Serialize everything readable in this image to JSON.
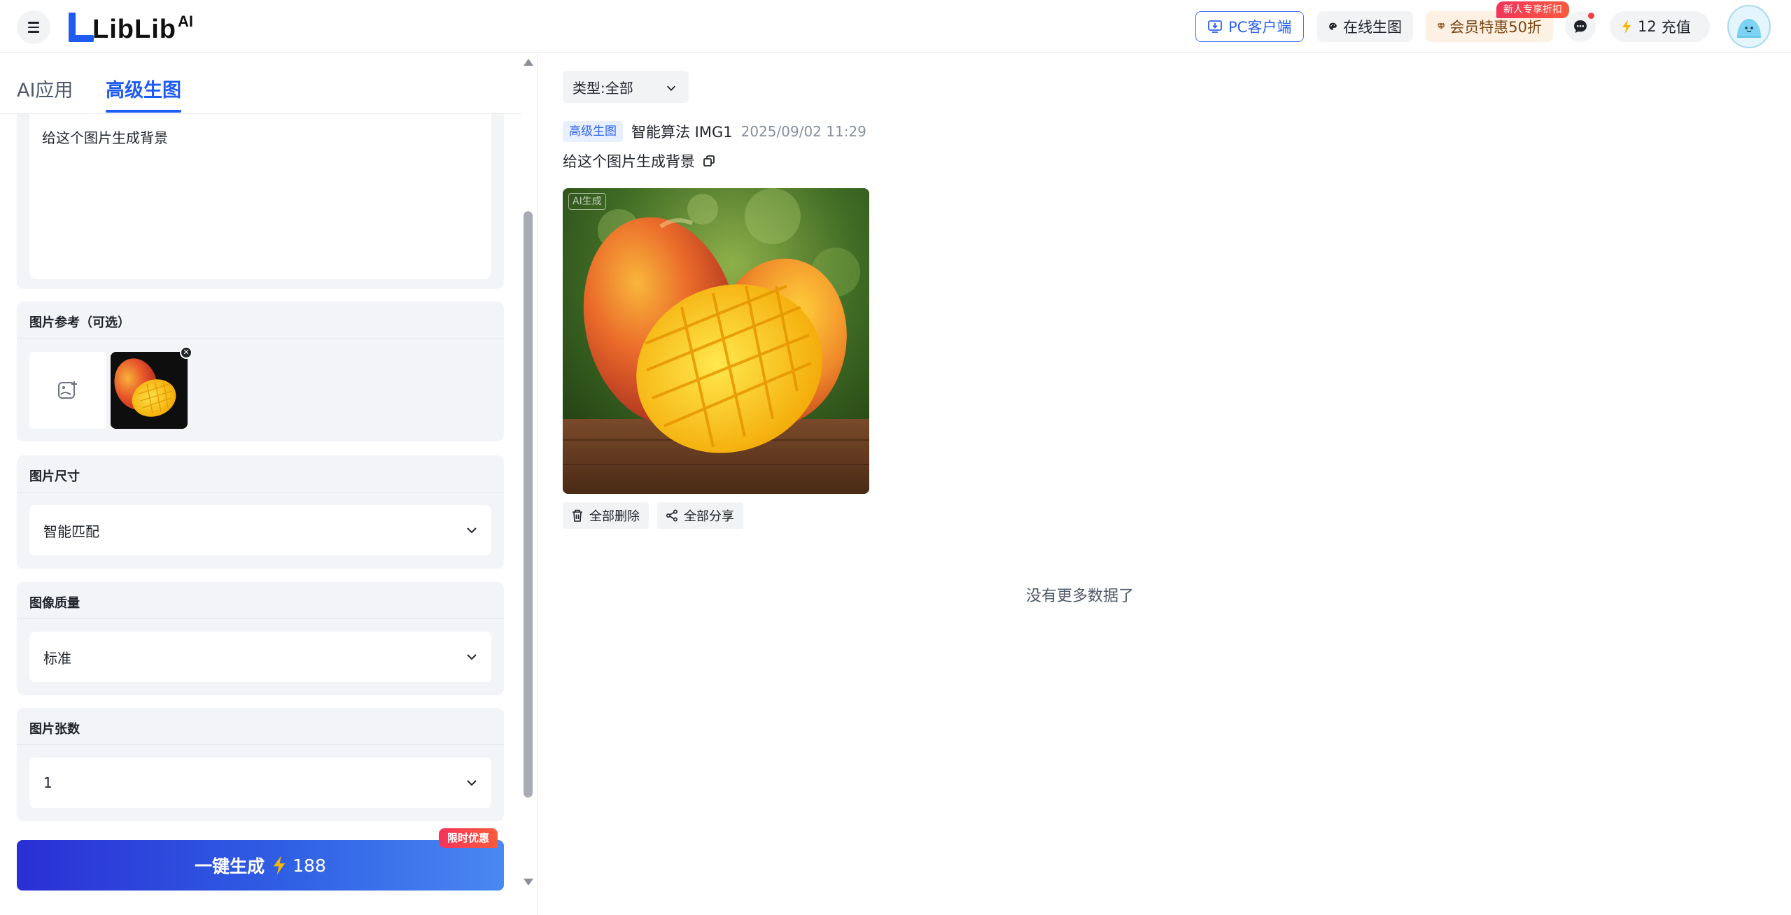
{
  "header": {
    "logo_text": "LibLib",
    "logo_suffix": "AI",
    "pc_client_label": "PC客户端",
    "online_gen_label": "在线生图",
    "vip_label": "会员特惠50折",
    "vip_badge": "新人专享折扣",
    "points": "12",
    "recharge_label": "充值"
  },
  "left_panel": {
    "tabs": [
      {
        "label": "AI应用",
        "active": false
      },
      {
        "label": "高级生图",
        "active": true
      }
    ],
    "prompt_text": "给这个图片生成背景",
    "image_reference": {
      "title": "图片参考（可选）"
    },
    "image_size": {
      "title": "图片尺寸",
      "value": "智能匹配"
    },
    "image_quality": {
      "title": "图像质量",
      "value": "标准"
    },
    "image_count": {
      "title": "图片张数",
      "value": "1"
    },
    "generate": {
      "label": "一键生成",
      "cost": "188",
      "badge": "限时优惠"
    }
  },
  "right_panel": {
    "type_filter": "类型:全部",
    "result": {
      "tag": "高级生图",
      "model": "智能算法 IMG1",
      "time": "2025/09/02 11:29",
      "prompt": "给这个图片生成背景",
      "ai_mark": "AI生成"
    },
    "actions": {
      "delete_all": "全部删除",
      "share_all": "全部分享"
    },
    "no_more": "没有更多数据了"
  },
  "colors": {
    "accent": "#1e5bf5",
    "panel_bg": "#f2f4f7",
    "badge_red": "#f2345b"
  }
}
